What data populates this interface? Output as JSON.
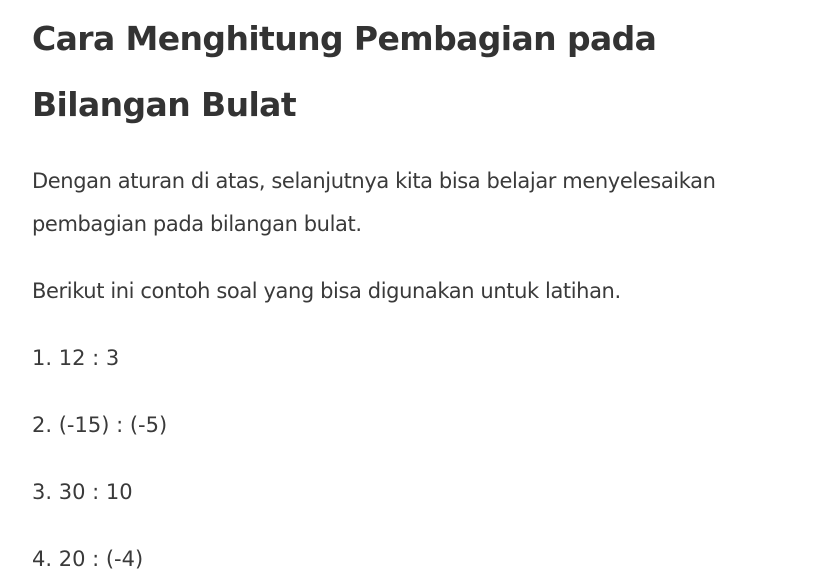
{
  "article": {
    "title": "Cara Menghitung Pembagian pada Bilangan Bulat",
    "paragraphs": [
      "Dengan aturan di atas, selanjutnya kita bisa belajar menyelesaikan pembagian pada bilangan bulat.",
      "Berikut ini contoh soal yang bisa digunakan untuk latihan."
    ],
    "problems": [
      "1. 12 : 3",
      "2. (-15) : (-5)",
      "3. 30 : 10",
      "4. 20 : (-4)"
    ]
  }
}
